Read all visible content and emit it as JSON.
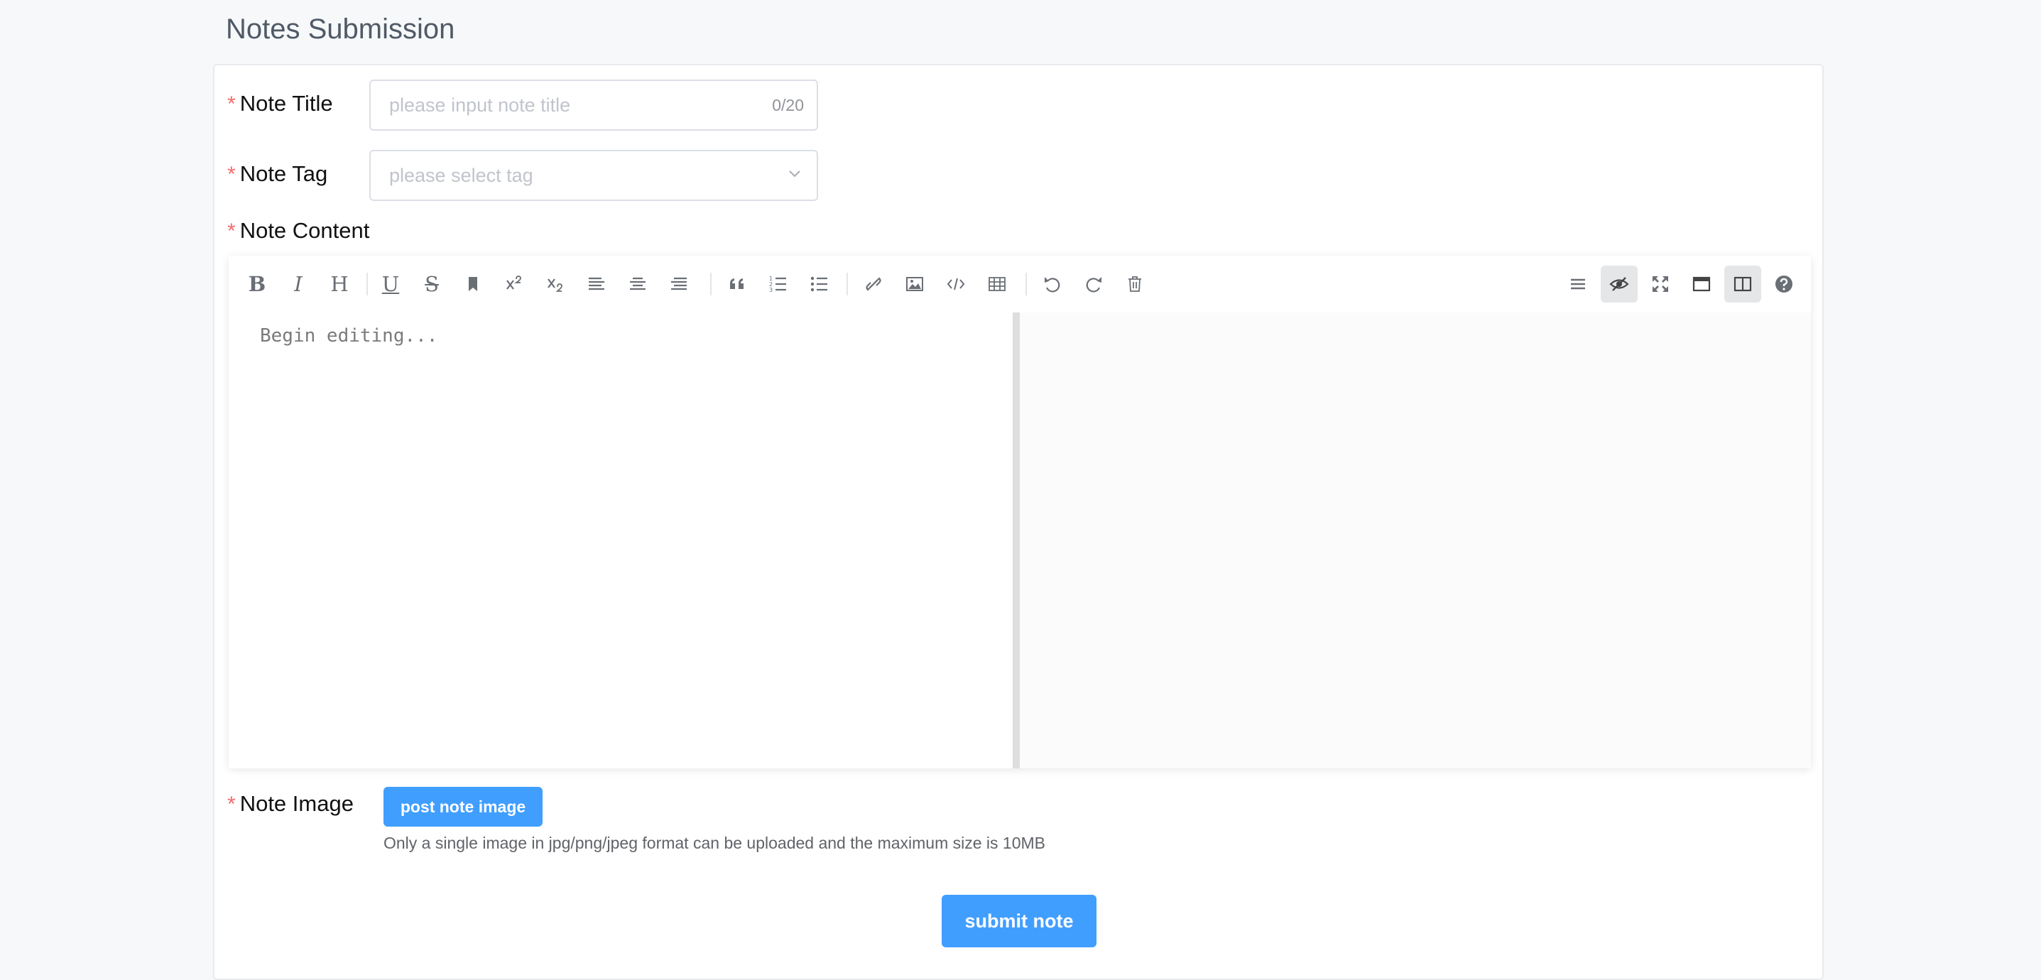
{
  "page": {
    "title": "Notes Submission"
  },
  "form": {
    "title_field": {
      "label": "Note Title",
      "placeholder": "please input note title",
      "counter": "0/20",
      "required": true
    },
    "tag_field": {
      "label": "Note Tag",
      "placeholder": "please select tag",
      "required": true
    },
    "content_field": {
      "label": "Note Content",
      "required": true
    },
    "image_field": {
      "label": "Note Image",
      "button_label": "post note image",
      "hint": "Only a single image in jpg/png/jpeg format can be uploaded and the maximum size is 10MB",
      "required": true
    },
    "required_mark": "*",
    "submit_label": "submit note"
  },
  "editor": {
    "placeholder": "Begin editing...",
    "toolbar_left": [
      "bold-icon",
      "italic-icon",
      "header-icon",
      "underline-icon",
      "strikethrough-icon",
      "mark-icon",
      "superscript-icon",
      "subscript-icon",
      "align-left-icon",
      "align-center-icon",
      "align-right-icon",
      "quote-icon",
      "ordered-list-icon",
      "unordered-list-icon",
      "link-icon",
      "image-icon",
      "code-icon",
      "table-icon",
      "undo-icon",
      "redo-icon",
      "trash-icon"
    ],
    "toolbar_right": [
      "navigation-icon",
      "preview-toggle-icon",
      "fullscreen-icon",
      "read-mode-icon",
      "subfield-icon",
      "help-icon"
    ],
    "toolbar_text": {
      "bold": "B",
      "italic": "I",
      "header": "H",
      "underline": "U",
      "strike": "S"
    }
  },
  "colors": {
    "primary": "#409eff",
    "required": "#f56c6c",
    "placeholder": "#c0c4cc"
  }
}
